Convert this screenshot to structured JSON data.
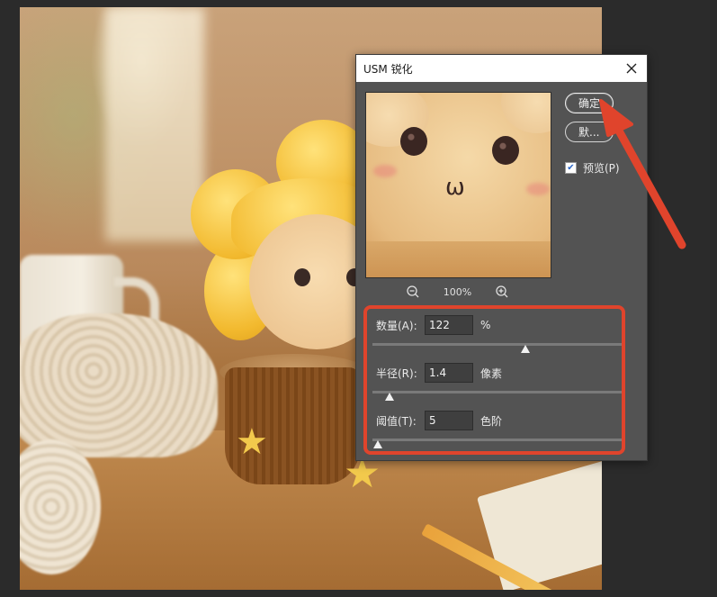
{
  "dialog": {
    "title": "USM 锐化",
    "ok_label": "确定",
    "reset_label": "默...",
    "preview_label": "预览(P)",
    "preview_checked": true,
    "zoom_level": "100%"
  },
  "params": {
    "amount": {
      "label": "数量(A):",
      "value": "122",
      "unit": "%",
      "slider_fraction": 0.61
    },
    "radius": {
      "label": "半径(R):",
      "value": "1.4",
      "unit": "像素",
      "slider_fraction": 0.07
    },
    "threshold": {
      "label": "阈值(T):",
      "value": "5",
      "unit": "色阶",
      "slider_fraction": 0.02
    }
  },
  "icons": {
    "close": "close-icon",
    "zoom_out": "zoom-out-icon",
    "zoom_in": "zoom-in-icon",
    "check": "check-icon"
  },
  "colors": {
    "dialog_bg": "#535353",
    "annotation": "#e0442c",
    "titlebar": "#ffffff"
  }
}
